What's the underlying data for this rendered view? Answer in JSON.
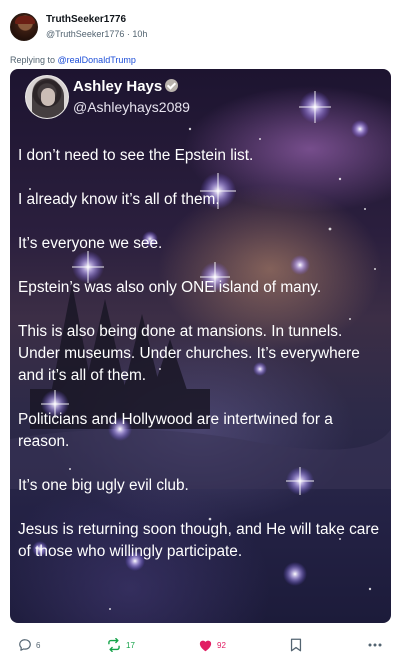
{
  "post": {
    "author_name": "TruthSeeker1776",
    "author_handle": "@TruthSeeker1776",
    "separator": " · ",
    "time_ago": "10h",
    "reply_prefix": "Replying to ",
    "reply_mention": "@realDonaldTrump"
  },
  "embedded_tweet": {
    "name": "Ashley Hays",
    "handle": "@Ashleyhays2089",
    "paragraphs": [
      "I don’t need to see the Epstein list.",
      "I already know it’s all of them.",
      "It’s everyone we see.",
      "Epstein’s was also only ONE island of many.",
      "This is also being done at mansions. In tunnels. Under museums. Under churches. It’s everywhere and it’s all of them.",
      "Politicians and Hollywood are intertwined for a reason.",
      "It’s one big ugly evil club.",
      "Jesus is returning soon though, and He will take care of those who willingly participate."
    ]
  },
  "actions": {
    "reply_count": "6",
    "repost_count": "17",
    "like_count": "92"
  },
  "colors": {
    "repost": "#16a34a",
    "like": "#e11d63",
    "mention": "#1d4ed8",
    "muted": "#536471"
  }
}
